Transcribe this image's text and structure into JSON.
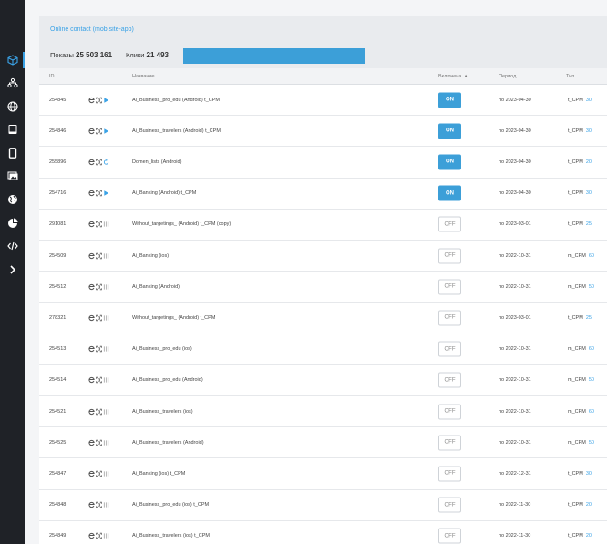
{
  "sidebar": {
    "items": [
      {
        "icon": "cube-icon",
        "active": true
      },
      {
        "icon": "hierarchy-icon",
        "active": false
      },
      {
        "icon": "globe-icon",
        "active": false
      },
      {
        "icon": "tablet-icon",
        "active": false
      },
      {
        "icon": "phone-icon",
        "active": false
      },
      {
        "icon": "images-icon",
        "active": false
      },
      {
        "icon": "world-icon",
        "active": false
      },
      {
        "icon": "pie-chart-icon",
        "active": false
      },
      {
        "icon": "code-icon",
        "active": false
      },
      {
        "icon": "chevron-right-icon",
        "active": false
      }
    ]
  },
  "panel": {
    "title": "Online contact (mob site-app)",
    "impressions_label": "Показы",
    "impressions_value": "25 503 161",
    "clicks_label": "Клики",
    "clicks_value": "21 493"
  },
  "columns": {
    "id": "ID",
    "name": "Название",
    "enabled": "Включена",
    "period": "Период",
    "type": "Тип"
  },
  "rows": [
    {
      "id": "254845",
      "status_icon": "play",
      "name": "Ai_Business_pro_edu (Android) t_CPM",
      "state": "ON",
      "period": "по 2023-04-30",
      "type": "t_CPM",
      "num": "30"
    },
    {
      "id": "254846",
      "status_icon": "play",
      "name": "Ai_Business_travelers (Android) t_CPM",
      "state": "ON",
      "period": "по 2023-04-30",
      "type": "t_CPM",
      "num": "30"
    },
    {
      "id": "255896",
      "status_icon": "refresh",
      "name": "Domen_lists (Android)",
      "state": "ON",
      "period": "по 2023-04-30",
      "type": "t_CPM",
      "num": "20"
    },
    {
      "id": "254716",
      "status_icon": "play",
      "name": "Ai_Banking (Android) t_CPM",
      "state": "ON",
      "period": "по 2023-04-30",
      "type": "t_CPM",
      "num": "30"
    },
    {
      "id": "291081",
      "status_icon": "pause",
      "name": "Without_targetings_ (Android) t_CPM (copy)",
      "state": "OFF",
      "period": "по 2023-03-01",
      "type": "t_CPM",
      "num": "25"
    },
    {
      "id": "254509",
      "status_icon": "pause",
      "name": "Ai_Banking (ios)",
      "state": "OFF",
      "period": "по 2022-10-31",
      "type": "m_CPM",
      "num": "60"
    },
    {
      "id": "254512",
      "status_icon": "pause",
      "name": "Ai_Banking (Android)",
      "state": "OFF",
      "period": "по 2022-10-31",
      "type": "m_CPM",
      "num": "50"
    },
    {
      "id": "278321",
      "status_icon": "pause",
      "name": "Without_targetings_ (Android) t_CPM",
      "state": "OFF",
      "period": "по 2023-03-01",
      "type": "t_CPM",
      "num": "25"
    },
    {
      "id": "254513",
      "status_icon": "pause",
      "name": "Ai_Business_pro_edu (ios)",
      "state": "OFF",
      "period": "по 2022-10-31",
      "type": "m_CPM",
      "num": "60"
    },
    {
      "id": "254514",
      "status_icon": "pause",
      "name": "Ai_Business_pro_edu (Android)",
      "state": "OFF",
      "period": "по 2022-10-31",
      "type": "m_CPM",
      "num": "50"
    },
    {
      "id": "254521",
      "status_icon": "pause",
      "name": "Ai_Business_travelers (ios)",
      "state": "OFF",
      "period": "по 2022-10-31",
      "type": "m_CPM",
      "num": "60"
    },
    {
      "id": "254525",
      "status_icon": "pause",
      "name": "Ai_Business_travelers (Android)",
      "state": "OFF",
      "period": "по 2022-10-31",
      "type": "m_CPM",
      "num": "50"
    },
    {
      "id": "254847",
      "status_icon": "pause",
      "name": "Ai_Banking (ios) t_CPM",
      "state": "OFF",
      "period": "по 2022-12-31",
      "type": "t_CPM",
      "num": "30"
    },
    {
      "id": "254848",
      "status_icon": "pause",
      "name": "Ai_Business_pro_edu (ios) t_CPM",
      "state": "OFF",
      "period": "по 2022-11-30",
      "type": "t_CPM",
      "num": "20"
    },
    {
      "id": "254849",
      "status_icon": "pause",
      "name": "Ai_Business_travelers (ios) t_CPM",
      "state": "OFF",
      "period": "по 2022-11-30",
      "type": "t_CPM",
      "num": "20"
    }
  ],
  "colors": {
    "accent": "#3aa2e6",
    "sidebar_bg": "#1f2227",
    "toggle_on": "#3c9fd8"
  }
}
